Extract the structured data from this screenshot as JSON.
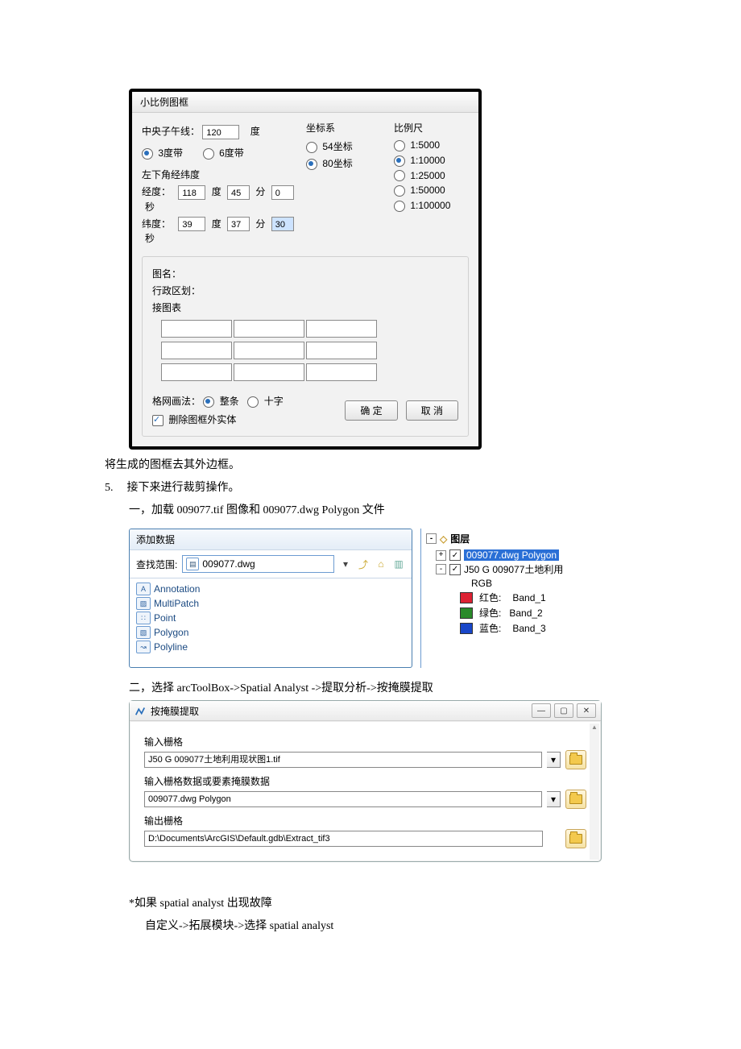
{
  "dlg1": {
    "title": "小比例图框",
    "meridian_label": "中央子午线：",
    "meridian_value": "120",
    "meridian_unit": "度",
    "belt3": "3度带",
    "belt6": "6度带",
    "coord_title": "坐标系",
    "coord54": "54坐标",
    "coord80": "80坐标",
    "scale_title": "比例尺",
    "scales": [
      "1:5000",
      "1:10000",
      "1:25000",
      "1:50000",
      "1:100000"
    ],
    "selected_scale_index": 1,
    "corner_title": "左下角经纬度",
    "lon_label": "经度：",
    "lon_deg": "118",
    "lon_deg_u": "度",
    "lon_min": "45",
    "lon_min_u": "分",
    "lon_sec": "0",
    "lon_sec_u": "秒",
    "lat_label": "纬度：",
    "lat_deg": "39",
    "lat_deg_u": "度",
    "lat_min": "37",
    "lat_min_u": "分",
    "lat_sec": "30",
    "lat_sec_u": "秒",
    "mapname_label": "图名：",
    "district_label": "行政区划：",
    "join_label": "接图表",
    "gridlaw_label": "格网画法：",
    "grid_full": "整条",
    "grid_cross": "十字",
    "del_outer": "删除图框外实体",
    "ok": "确   定",
    "cancel": "取   消"
  },
  "text": {
    "l1": "将生成的图框去其外边框。",
    "l2_num": "5.",
    "l2": "接下来进行裁剪操作。",
    "l3": "一，加载 009077.tif 图像和 009077.dwg Polygon 文件",
    "step2": "二，选择 arcToolBox->Spatial Analyst ->提取分析->按掩膜提取",
    "note1": "*如果 spatial analyst 出现故障",
    "note2": "自定义->拓展模块->选择 spatial analyst"
  },
  "dlg2": {
    "title": "添加数据",
    "lookin_label": "查找范围:",
    "lookin_value": "009077.dwg",
    "items": [
      {
        "icon": "A",
        "label": "Annotation"
      },
      {
        "icon": "▨",
        "label": "MultiPatch"
      },
      {
        "icon": "∷",
        "label": "Point"
      },
      {
        "icon": "▧",
        "label": "Polygon"
      },
      {
        "icon": "↝",
        "label": "Polyline"
      }
    ]
  },
  "layers": {
    "title": "图层",
    "row1": "009077.dwg Polygon",
    "row2": "J50 G 009077土地利用",
    "rgb": "RGB",
    "bands": [
      {
        "color": "#d23",
        "label": "红色:",
        "name": "Band_1"
      },
      {
        "color": "#2a8a2a",
        "label": "绿色:",
        "name": "Band_2"
      },
      {
        "color": "#1846c8",
        "label": "蓝色:",
        "name": "Band_3"
      }
    ]
  },
  "dlg3": {
    "title": "按掩膜提取",
    "f1_label": "输入栅格",
    "f1_value": "J50 G 009077土地利用现状图1.tif",
    "f2_label": "输入栅格数据或要素掩膜数据",
    "f2_value": "009077.dwg Polygon",
    "f3_label": "输出栅格",
    "f3_value": "D:\\Documents\\ArcGIS\\Default.gdb\\Extract_tif3"
  }
}
